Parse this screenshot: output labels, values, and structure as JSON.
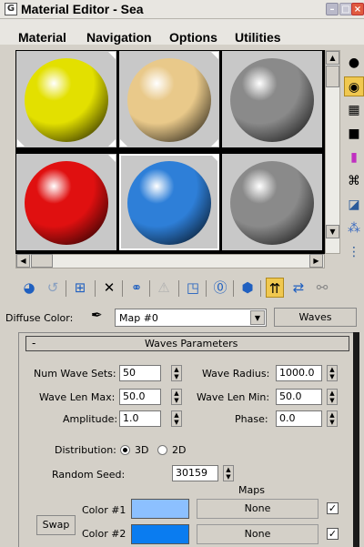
{
  "window": {
    "title": "Material Editor - Sea"
  },
  "menu": [
    "Material",
    "Navigation",
    "Options",
    "Utilities"
  ],
  "slots": [
    {
      "color": "#e3e000",
      "active": false
    },
    {
      "color": "#e9c98a",
      "active": false
    },
    {
      "color": "#8a8a8a",
      "active": false
    },
    {
      "color": "#e01010",
      "active": false
    },
    {
      "color": "#2e7fd8",
      "active": true
    },
    {
      "color": "#8a8a8a",
      "active": false
    }
  ],
  "right_toolbar": [
    "sample-type-sphere-icon",
    "backlight-icon",
    "background-checker-icon",
    "sample-uv-tiling-icon",
    "video-color-check-icon",
    "make-preview-icon",
    "options-icon",
    "select-by-material-icon",
    "material-map-navigator-icon"
  ],
  "bottom_toolbar": [
    "get-material-icon",
    "put-material-icon",
    "assign-material-icon",
    "reset-map-icon",
    "make-unique-icon",
    "put-to-library-icon",
    "material-effects-channel-icon",
    "show-map-in-viewport-icon",
    "show-end-result-icon",
    "go-to-parent-icon",
    "go-forward-to-sibling-icon"
  ],
  "diffuse": {
    "label": "Diffuse Color:",
    "map_value": "Map #0",
    "type_button": "Waves"
  },
  "rollout": {
    "toggle": "-",
    "title": "Waves Parameters",
    "num_wave_sets": {
      "label": "Num Wave Sets:",
      "value": "50"
    },
    "wave_radius": {
      "label": "Wave Radius:",
      "value": "1000.0"
    },
    "wave_len_max": {
      "label": "Wave Len Max:",
      "value": "50.0"
    },
    "wave_len_min": {
      "label": "Wave Len Min:",
      "value": "50.0"
    },
    "amplitude": {
      "label": "Amplitude:",
      "value": "1.0"
    },
    "phase": {
      "label": "Phase:",
      "value": "0.0"
    },
    "distribution": {
      "label": "Distribution:",
      "opt3d": "3D",
      "opt2d": "2D",
      "selected": "3D"
    },
    "random_seed": {
      "label": "Random Seed:",
      "value": "30159"
    },
    "maps_header": "Maps",
    "swap": "Swap",
    "color1": {
      "label": "Color #1",
      "swatch": "#8cc0ff",
      "map": "None",
      "checked": true
    },
    "color2": {
      "label": "Color #2",
      "swatch": "#0a7cf0",
      "map": "None",
      "checked": true
    }
  }
}
